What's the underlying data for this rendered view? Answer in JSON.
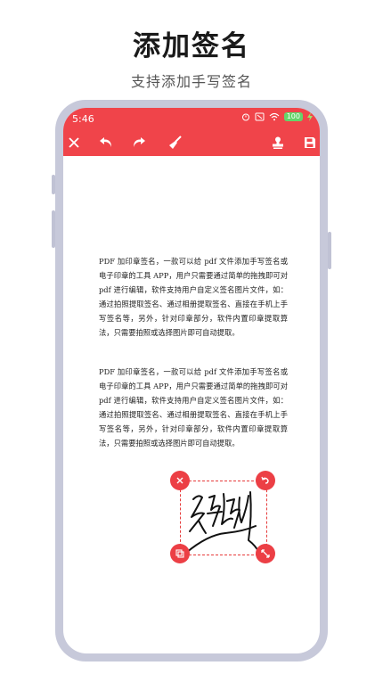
{
  "promo": {
    "title": "添加签名",
    "subtitle": "支持添加手写签名"
  },
  "colors": {
    "accent": "#f0444a",
    "frame": "#c7c9da",
    "signature_border": "#e63b3b"
  },
  "status_bar": {
    "time": "5:46",
    "battery": "100"
  },
  "toolbar": {
    "icons": [
      "close-icon",
      "undo-icon",
      "redo-icon",
      "broom-icon",
      "stamp-icon",
      "save-icon"
    ]
  },
  "document": {
    "paragraphs": [
      "PDF 加印章签名，一款可以给 pdf 文件添加手写签名或电子印章的工具 APP，用户只需要通过简单的拖拽即可对 pdf 进行编辑，软件支持用户自定义签名图片文件，如：通过拍照提取签名、通过相册提取签名、直接在手机上手写签名等，另外，针对印章部分，软件内置印章提取算法，只需要拍照或选择图片即可自动提取。",
      "PDF 加印章签名，一款可以给 pdf 文件添加手写签名或电子印章的工具 APP，用户只需要通过简单的拖拽即可对 pdf 进行编辑，软件支持用户自定义签名图片文件，如：通过拍照提取签名、通过相册提取签名、直接在手机上手写签名等，另外，针对印章部分，软件内置印章提取算法，只需要拍照或选择图片即可自动提取。"
    ]
  },
  "signature": {
    "handles": [
      "delete-handle-icon",
      "rotate-handle-icon",
      "copy-handle-icon",
      "resize-handle-icon"
    ]
  }
}
